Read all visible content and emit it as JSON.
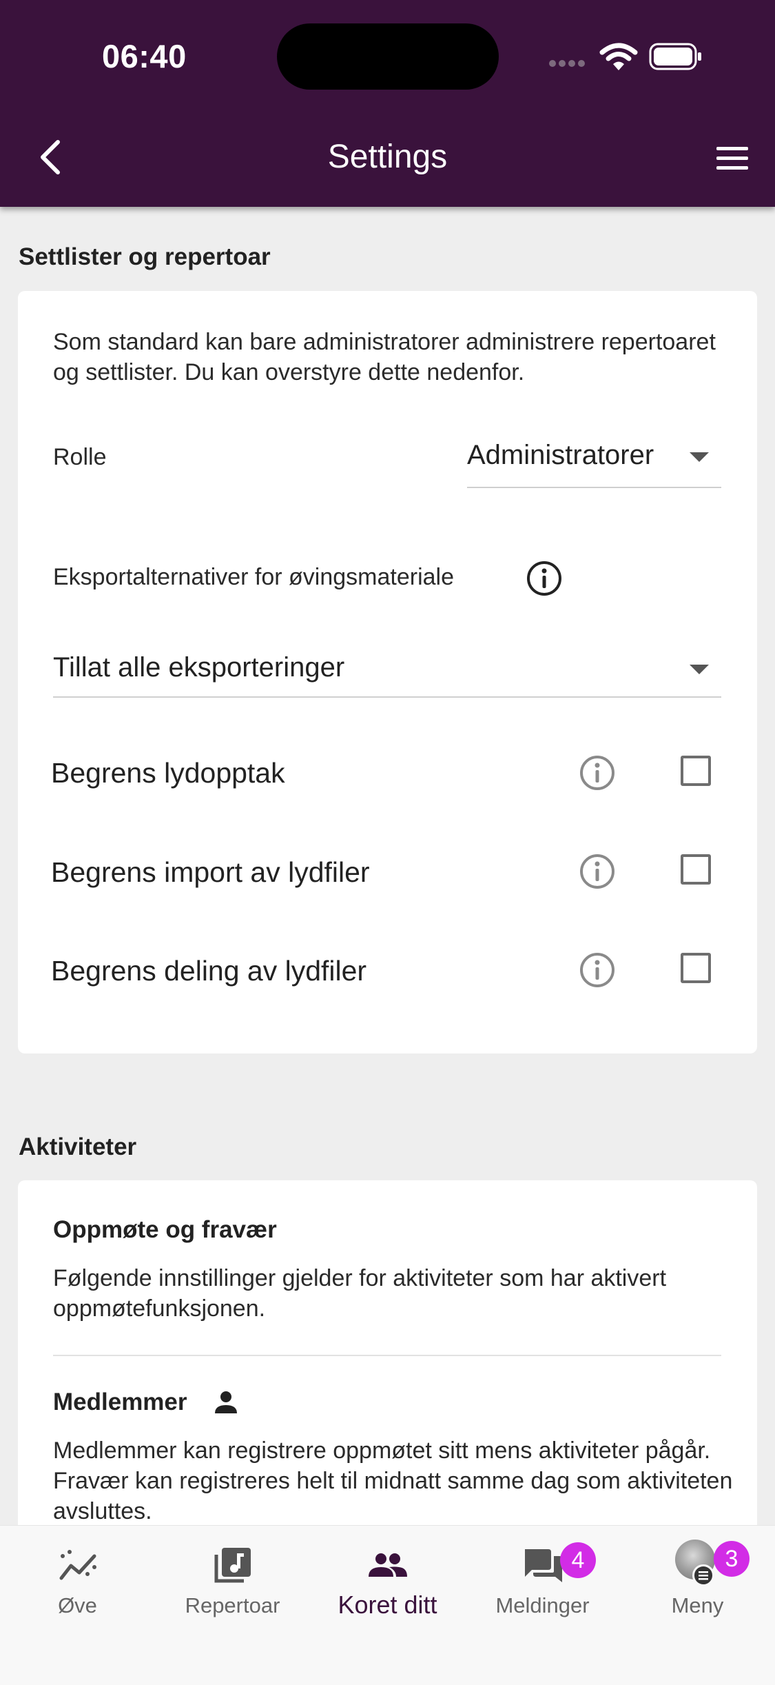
{
  "status_bar": {
    "time": "06:40"
  },
  "header": {
    "title": "Settings"
  },
  "section_setlists": {
    "title": "Settlister og repertoar",
    "intro": "Som standard kan bare administratorer administrere repertoaret og settlister. Du kan overstyre dette nedenfor.",
    "role_label": "Rolle",
    "role_value": "Administratorer",
    "export_label": "Eksportalternativer for øvingsmateriale",
    "export_value": "Tillat alle eksporteringer",
    "rows": [
      {
        "label": "Begrens lydopptak",
        "checked": false
      },
      {
        "label": "Begrens import av lydfiler",
        "checked": false
      },
      {
        "label": "Begrens deling av lydfiler",
        "checked": false
      }
    ]
  },
  "section_activities": {
    "title": "Aktiviteter",
    "attendance_title": "Oppmøte og fravær",
    "attendance_text": "Følgende innstillinger gjelder for aktiviteter som har aktivert oppmøtefunksjonen.",
    "members_title": "Medlemmer",
    "members_text": "Medlemmer kan registrere oppmøtet sitt mens aktiviteter pågår. Fravær kan registreres helt til midnatt samme dag som aktiviteten avsluttes."
  },
  "tabbar": {
    "tabs": [
      {
        "label": "Øve",
        "icon": "practice-chart-icon"
      },
      {
        "label": "Repertoar",
        "icon": "music-library-icon"
      },
      {
        "label": "Koret ditt",
        "icon": "group-icon",
        "active": true
      },
      {
        "label": "Meldinger",
        "icon": "chat-icon",
        "badge": "4"
      },
      {
        "label": "Meny",
        "icon": "avatar",
        "badge": "3"
      }
    ]
  },
  "colors": {
    "header_bg": "#3a123c",
    "badge": "#d22ce6",
    "active_tab": "#3a123c"
  }
}
